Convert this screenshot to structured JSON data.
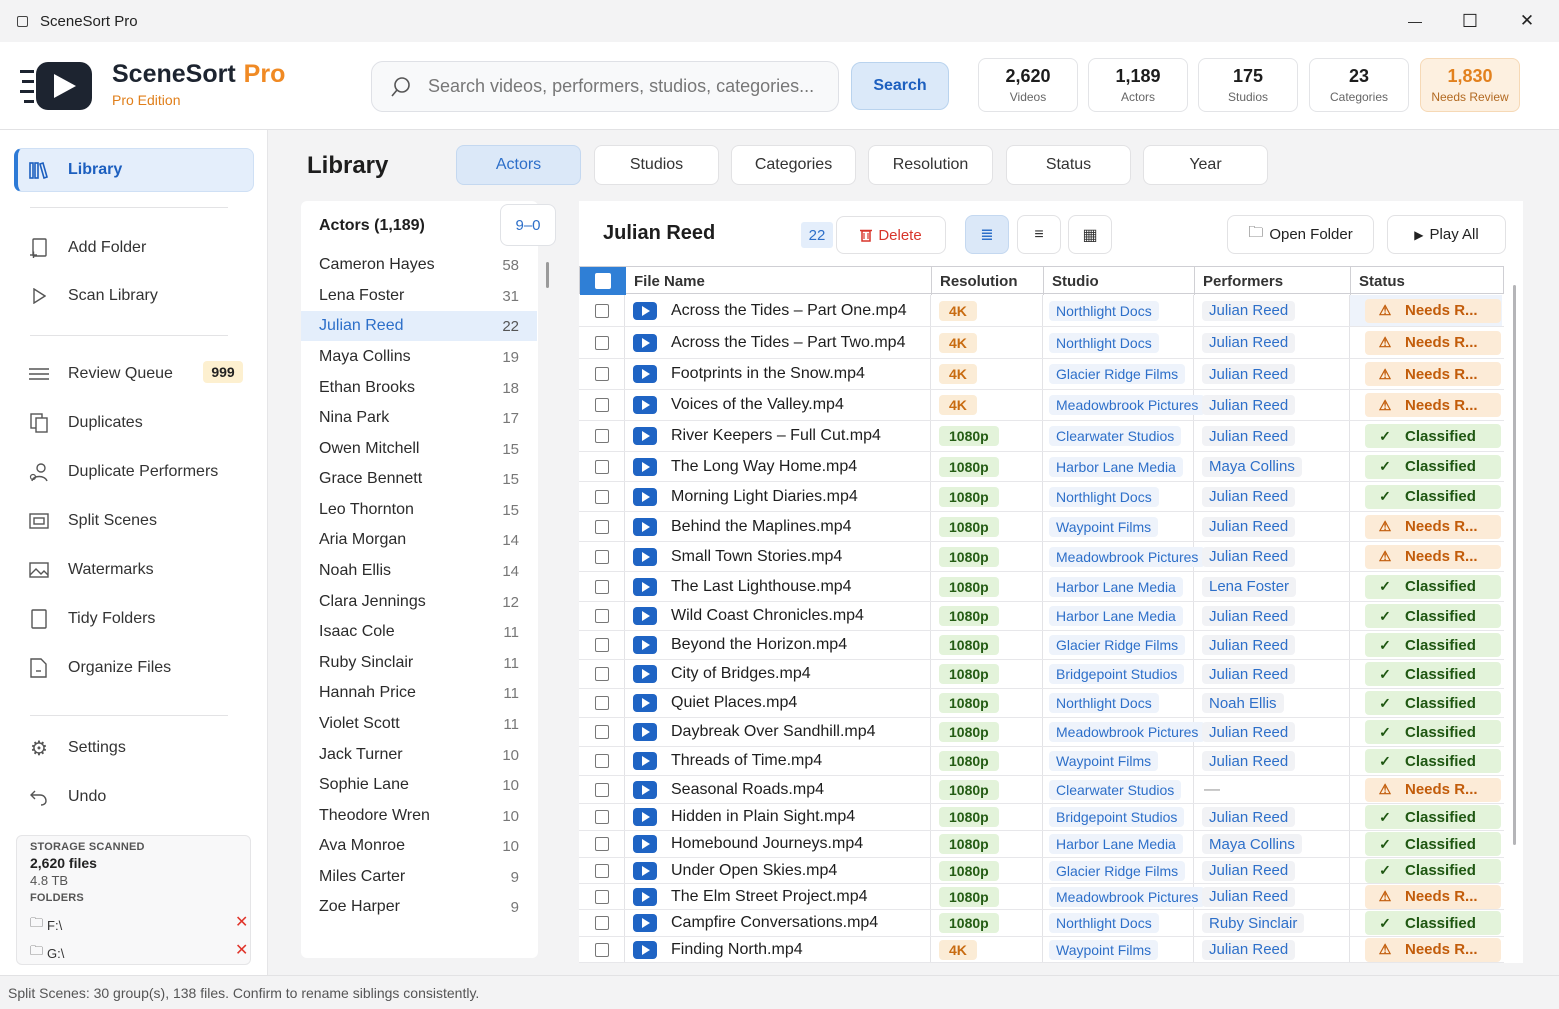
{
  "window": {
    "title": "SceneSort Pro",
    "minimize": "—",
    "maximize": "☐",
    "close": "✕"
  },
  "header": {
    "brand": "SceneSort",
    "brand_suffix": "Pro",
    "edition": "Pro Edition",
    "search_placeholder": "Search videos, performers, studios, categories...",
    "search_button": "Search",
    "stats": [
      {
        "value": "2,620",
        "label": "Videos"
      },
      {
        "value": "1,189",
        "label": "Actors"
      },
      {
        "value": "175",
        "label": "Studios"
      },
      {
        "value": "23",
        "label": "Categories"
      },
      {
        "value": "1,830",
        "label": "Needs Review"
      }
    ]
  },
  "sidebar": {
    "items": [
      {
        "label": "Library",
        "icon": "library-icon"
      },
      {
        "label": "Add Folder",
        "icon": "add-folder-icon"
      },
      {
        "label": "Scan Library",
        "icon": "play-outline-icon"
      },
      {
        "label": "Review Queue",
        "icon": "list-icon",
        "badge": "999"
      },
      {
        "label": "Duplicates",
        "icon": "copy-icon"
      },
      {
        "label": "Duplicate Performers",
        "icon": "person-icon"
      },
      {
        "label": "Split Scenes",
        "icon": "split-icon"
      },
      {
        "label": "Watermarks",
        "icon": "image-icon"
      },
      {
        "label": "Tidy Folders",
        "icon": "folder-icon"
      },
      {
        "label": "Organize Files",
        "icon": "file-icon"
      },
      {
        "label": "Settings",
        "icon": "gear-icon"
      },
      {
        "label": "Undo",
        "icon": "undo-icon"
      }
    ],
    "storage": {
      "caption": "STORAGE SCANNED",
      "files": "2,620 files",
      "size": "4.8 TB",
      "folders_caption": "FOLDERS",
      "folders": [
        "F:\\",
        "G:\\"
      ]
    }
  },
  "library": {
    "title": "Library",
    "tabs": [
      "Actors",
      "Studios",
      "Categories",
      "Resolution",
      "Status",
      "Year"
    ],
    "actors_header": "Actors (1,189)",
    "sort_label": "9–0",
    "actors": [
      {
        "name": "Cameron Hayes",
        "count": "58"
      },
      {
        "name": "Lena Foster",
        "count": "31"
      },
      {
        "name": "Julian Reed",
        "count": "22"
      },
      {
        "name": "Maya Collins",
        "count": "19"
      },
      {
        "name": "Ethan Brooks",
        "count": "18"
      },
      {
        "name": "Nina Park",
        "count": "17"
      },
      {
        "name": "Owen Mitchell",
        "count": "15"
      },
      {
        "name": "Grace Bennett",
        "count": "15"
      },
      {
        "name": "Leo Thornton",
        "count": "15"
      },
      {
        "name": "Aria Morgan",
        "count": "14"
      },
      {
        "name": "Noah Ellis",
        "count": "14"
      },
      {
        "name": "Clara Jennings",
        "count": "12"
      },
      {
        "name": "Isaac Cole",
        "count": "11"
      },
      {
        "name": "Ruby Sinclair",
        "count": "11"
      },
      {
        "name": "Hannah Price",
        "count": "11"
      },
      {
        "name": "Violet Scott",
        "count": "11"
      },
      {
        "name": "Jack Turner",
        "count": "10"
      },
      {
        "name": "Sophie Lane",
        "count": "10"
      },
      {
        "name": "Theodore Wren",
        "count": "10"
      },
      {
        "name": "Ava Monroe",
        "count": "10"
      },
      {
        "name": "Miles Carter",
        "count": "9"
      },
      {
        "name": "Zoe Harper",
        "count": "9"
      }
    ]
  },
  "detail": {
    "title": "Julian Reed",
    "count": "22",
    "delete_label": "Delete",
    "open_folder": "Open Folder",
    "play_all": "Play All",
    "columns": [
      "File Name",
      "Resolution",
      "Studio",
      "Performers",
      "Status"
    ],
    "rows": [
      {
        "file": "Across the Tides – Part One.mp4",
        "res": "4K",
        "studio": "Northlight Docs",
        "performer": "Julian Reed",
        "status": "Needs R..."
      },
      {
        "file": "Across the Tides – Part Two.mp4",
        "res": "4K",
        "studio": "Northlight Docs",
        "performer": "Julian Reed",
        "status": "Needs R..."
      },
      {
        "file": "Footprints in the Snow.mp4",
        "res": "4K",
        "studio": "Glacier Ridge Films",
        "performer": "Julian Reed",
        "status": "Needs R..."
      },
      {
        "file": "Voices of the Valley.mp4",
        "res": "4K",
        "studio": "Meadowbrook Pictures",
        "performer": "Julian Reed",
        "status": "Needs R..."
      },
      {
        "file": "River Keepers – Full Cut.mp4",
        "res": "1080p",
        "studio": "Clearwater Studios",
        "performer": "Julian Reed",
        "status": "Classified"
      },
      {
        "file": "The Long Way Home.mp4",
        "res": "1080p",
        "studio": "Harbor Lane Media",
        "performer": "Maya Collins",
        "status": "Classified"
      },
      {
        "file": "Morning Light Diaries.mp4",
        "res": "1080p",
        "studio": "Northlight Docs",
        "performer": "Julian Reed",
        "status": "Classified"
      },
      {
        "file": "Behind the Maplines.mp4",
        "res": "1080p",
        "studio": "Waypoint Films",
        "performer": "Julian Reed",
        "status": "Needs R..."
      },
      {
        "file": "Small Town Stories.mp4",
        "res": "1080p",
        "studio": "Meadowbrook Pictures",
        "performer": "Julian Reed",
        "status": "Needs R..."
      },
      {
        "file": "The Last Lighthouse.mp4",
        "res": "1080p",
        "studio": "Harbor Lane Media",
        "performer": "Lena Foster",
        "status": "Classified"
      },
      {
        "file": "Wild Coast Chronicles.mp4",
        "res": "1080p",
        "studio": "Harbor Lane Media",
        "performer": "Julian Reed",
        "status": "Classified"
      },
      {
        "file": "Beyond the Horizon.mp4",
        "res": "1080p",
        "studio": "Glacier Ridge Films",
        "performer": "Julian Reed",
        "status": "Classified"
      },
      {
        "file": "City of Bridges.mp4",
        "res": "1080p",
        "studio": "Bridgepoint Studios",
        "performer": "Julian Reed",
        "status": "Classified"
      },
      {
        "file": "Quiet Places.mp4",
        "res": "1080p",
        "studio": "Northlight Docs",
        "performer": "Noah Ellis",
        "status": "Classified"
      },
      {
        "file": "Daybreak Over Sandhill.mp4",
        "res": "1080p",
        "studio": "Meadowbrook Pictures",
        "performer": "Julian Reed",
        "status": "Classified"
      },
      {
        "file": "Threads of Time.mp4",
        "res": "1080p",
        "studio": "Waypoint Films",
        "performer": "Julian Reed",
        "status": "Classified"
      },
      {
        "file": "Seasonal Roads.mp4",
        "res": "1080p",
        "studio": "Clearwater Studios",
        "performer": "—",
        "status": "Needs R..."
      },
      {
        "file": "Hidden in Plain Sight.mp4",
        "res": "1080p",
        "studio": "Bridgepoint Studios",
        "performer": "Julian Reed",
        "status": "Classified"
      },
      {
        "file": "Homebound Journeys.mp4",
        "res": "1080p",
        "studio": "Harbor Lane Media",
        "performer": "Maya Collins",
        "status": "Classified"
      },
      {
        "file": "Under Open Skies.mp4",
        "res": "1080p",
        "studio": "Glacier Ridge Films",
        "performer": "Julian Reed",
        "status": "Classified"
      },
      {
        "file": "The Elm Street Project.mp4",
        "res": "1080p",
        "studio": "Meadowbrook Pictures",
        "performer": "Julian Reed",
        "status": "Needs R..."
      },
      {
        "file": "Campfire Conversations.mp4",
        "res": "1080p",
        "studio": "Northlight Docs",
        "performer": "Ruby Sinclair",
        "status": "Classified"
      },
      {
        "file": "Finding North.mp4",
        "res": "4K",
        "studio": "Waypoint Films",
        "performer": "Julian Reed",
        "status": "Needs R..."
      }
    ]
  },
  "statusbar": {
    "text": "Split Scenes: 30 group(s), 138 files. Confirm to rename siblings consistently."
  },
  "colors": {
    "accent": "#2d7ad6",
    "brand_orange": "#f08a24",
    "needs_review": "#c25c0a",
    "classified": "#1f5712",
    "danger": "#d8352b"
  }
}
